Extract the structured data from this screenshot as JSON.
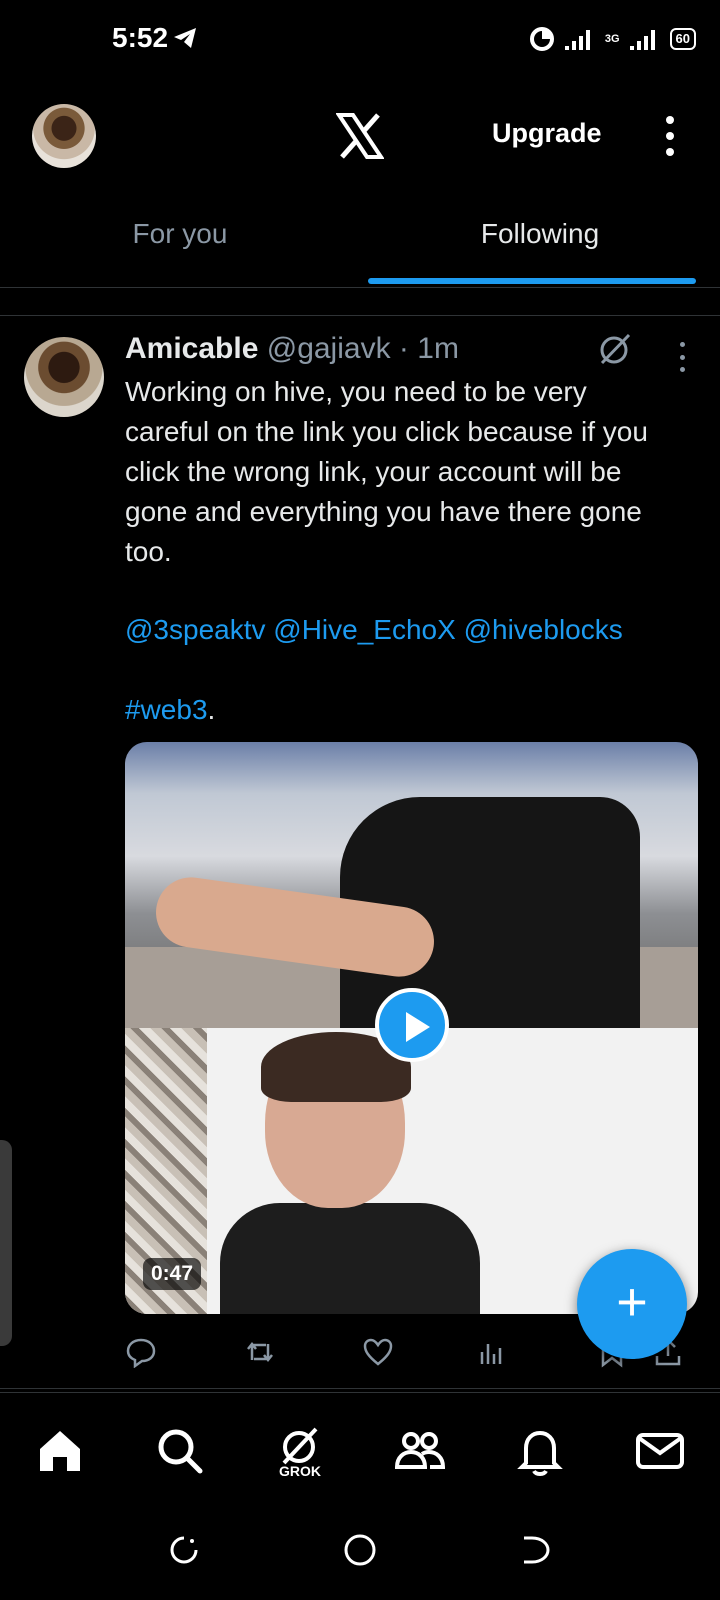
{
  "status_bar": {
    "time": "5:52",
    "network": "3G",
    "battery": "60",
    "icons": [
      "telegram-icon",
      "data-saver-icon",
      "signal-icon",
      "signal-3g-icon",
      "battery-icon"
    ]
  },
  "header": {
    "logo": "x-logo-icon",
    "upgrade_label": "Upgrade",
    "more_icon": "more-vertical-icon"
  },
  "tabs": [
    {
      "label": "For you",
      "selected": false
    },
    {
      "label": "Following",
      "selected": true
    }
  ],
  "tweet": {
    "author_name": "Amicable",
    "handle": "@gajiavk",
    "separator": "·",
    "time": "1m",
    "text": "Working on hive, you need to be very careful on the link you click because if you click the wrong link, your account will be gone and everything you have there gone too.",
    "mentions": [
      "@3speaktv",
      "@Hive_EchoX",
      "@hiveblocks"
    ],
    "hashtag": "#web3",
    "hashtag_suffix": ".",
    "media": {
      "type": "video",
      "duration": "0:47"
    },
    "actions": [
      "reply-icon",
      "retweet-icon",
      "like-icon",
      "views-icon",
      "bookmark-icon",
      "share-icon"
    ]
  },
  "fab": {
    "label": "+",
    "icon": "compose-plus-icon"
  },
  "bottom_nav": {
    "items": [
      "home-icon",
      "search-icon",
      "grok-icon",
      "communities-icon",
      "notifications-icon",
      "messages-icon"
    ],
    "grok_label": "GROK",
    "active": "home"
  },
  "system_nav": [
    "recents-icon",
    "home-circle-icon",
    "back-icon"
  ],
  "colors": {
    "background": "#000000",
    "accent": "#1d9bf0",
    "text": "#e7e9ea",
    "muted": "#8b98a5",
    "divider": "#2f3336"
  }
}
